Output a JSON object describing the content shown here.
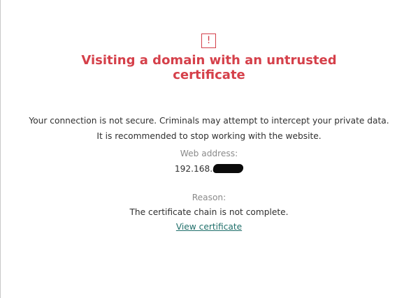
{
  "page": {
    "icon": "exclamation-warning-icon",
    "icon_glyph": "!",
    "title": "Visiting a domain with an untrusted certificate",
    "message": "Your connection is not secure. Criminals may attempt to intercept your private data. It is recommended to stop working with the website.",
    "web_address_label": "Web address:",
    "web_address_value": "192.168.",
    "reason_label": "Reason:",
    "reason_value": "The certificate chain is not complete.",
    "view_certificate_link": "View certificate"
  },
  "colors": {
    "warning_red": "#d5404a",
    "link_teal": "#1f6f6a",
    "label_gray": "#8a8a8a",
    "text_dark": "#2f2f2f"
  }
}
